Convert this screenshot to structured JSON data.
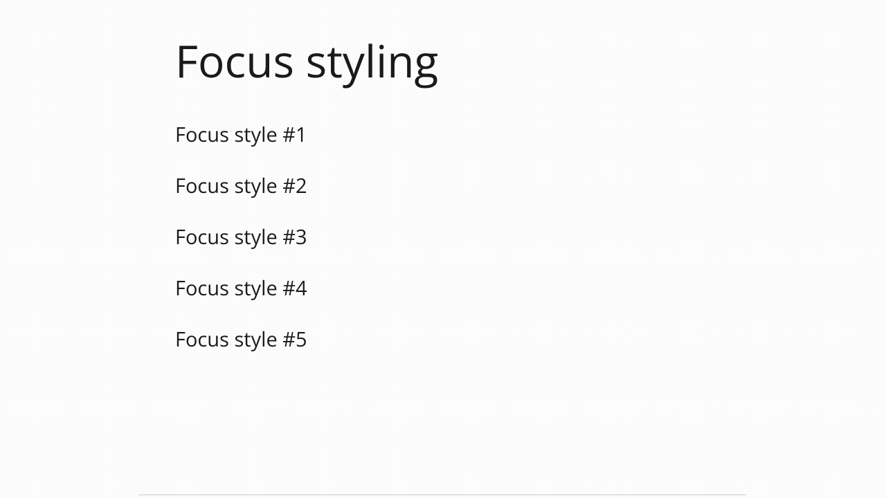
{
  "heading": "Focus styling",
  "items": [
    "Focus style #1",
    "Focus style #2",
    "Focus style #3",
    "Focus style #4",
    "Focus style #5"
  ]
}
